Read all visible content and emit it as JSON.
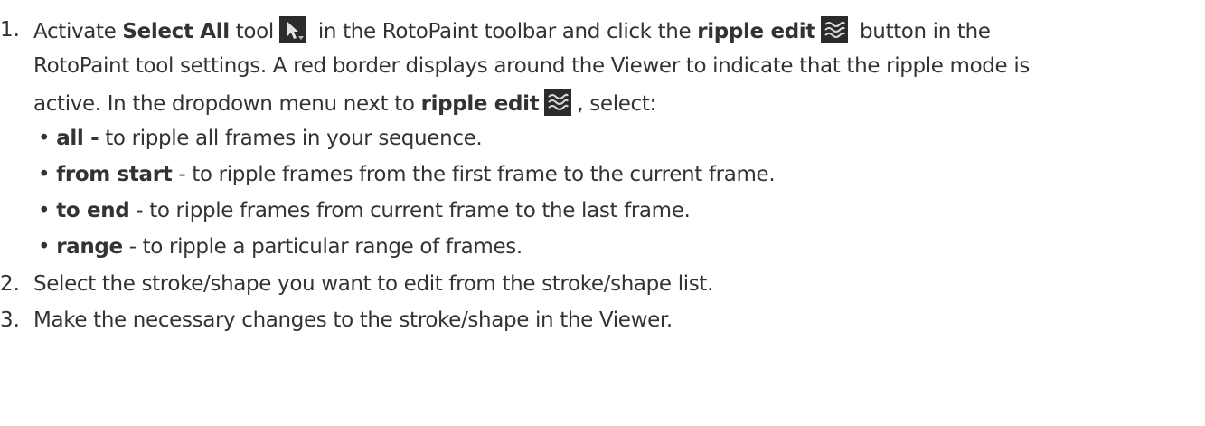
{
  "steps": [
    {
      "number": "1.",
      "part_a": "Activate ",
      "select_all": "Select All",
      "part_b": " tool",
      "part_c": " in the RotoPaint toolbar and click the ",
      "ripple_edit": "ripple edit",
      "part_d": " button in the",
      "line2": "RotoPaint tool settings. A red border displays around the Viewer to indicate that the ripple mode is",
      "line3_a": "active. In the dropdown menu next to ",
      "line3_ripple_edit": "ripple edit",
      "line3_b": ", select:",
      "options": [
        {
          "bullet": "•",
          "label": "all -",
          "desc": " to ripple all frames in your sequence."
        },
        {
          "bullet": "•",
          "label": "from start",
          "desc": " - to ripple frames from the first frame to the current frame."
        },
        {
          "bullet": "•",
          "label": "to end",
          "desc": " - to ripple frames from current frame to the last frame."
        },
        {
          "bullet": "•",
          "label": "range",
          "desc": " - to ripple a particular range of frames."
        }
      ]
    },
    {
      "number": "2.",
      "text": "Select the stroke/shape you want to edit from the stroke/shape list."
    },
    {
      "number": "3.",
      "text": "Make the necessary changes to the stroke/shape in the Viewer."
    }
  ],
  "icons": {
    "select_all": "select-all-arrow-icon",
    "ripple_edit": "ripple-edit-waves-icon"
  },
  "colors": {
    "text": "#333333",
    "icon_bg": "#2b2b2b",
    "icon_fg": "#d8d8d8"
  }
}
